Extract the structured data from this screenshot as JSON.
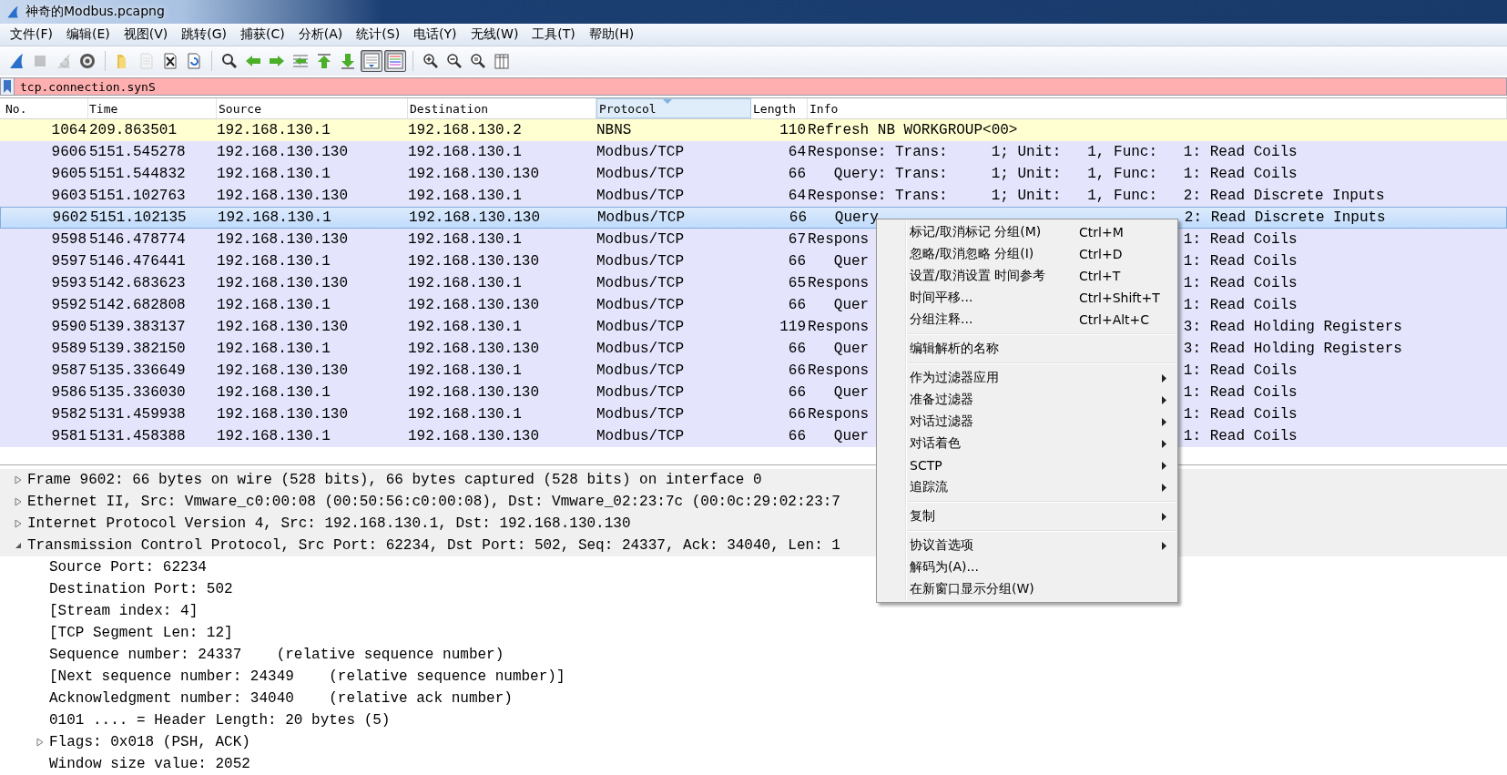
{
  "window": {
    "title": "神奇的Modbus.pcapng"
  },
  "menu_bar": [
    "文件(F)",
    "编辑(E)",
    "视图(V)",
    "跳转(G)",
    "捕获(C)",
    "分析(A)",
    "统计(S)",
    "电话(Y)",
    "无线(W)",
    "工具(T)",
    "帮助(H)"
  ],
  "toolbar": {
    "buttons": [
      {
        "disabled": false,
        "on": false
      },
      {
        "disabled": true,
        "on": false
      },
      {
        "disabled": true,
        "on": false
      },
      {
        "disabled": false,
        "on": false
      },
      {
        "disabled": false,
        "on": false
      },
      {
        "disabled": true,
        "on": false
      },
      {
        "disabled": false,
        "on": false
      },
      {
        "disabled": false,
        "on": false
      },
      {
        "disabled": false,
        "on": false
      },
      {
        "disabled": false,
        "on": false
      },
      {
        "disabled": false,
        "on": false
      },
      {
        "disabled": false,
        "on": false
      },
      {
        "disabled": false,
        "on": false
      },
      {
        "disabled": false,
        "on": false
      },
      {
        "disabled": false,
        "on": true
      },
      {
        "disabled": false,
        "on": true
      },
      {
        "disabled": false,
        "on": false
      },
      {
        "disabled": false,
        "on": false
      },
      {
        "disabled": false,
        "on": false
      },
      {
        "disabled": false,
        "on": false
      }
    ]
  },
  "display_filter": {
    "value": "tcp.connection.synS"
  },
  "packet_list": {
    "columns": [
      {
        "label": "No.",
        "sorted": false
      },
      {
        "label": "Time",
        "sorted": false
      },
      {
        "label": "Source",
        "sorted": false
      },
      {
        "label": "Destination",
        "sorted": false
      },
      {
        "label": "Protocol",
        "sorted": true
      },
      {
        "label": "Length",
        "sorted": false
      },
      {
        "label": "Info",
        "sorted": false
      }
    ],
    "rows": [
      {
        "no": "1064",
        "time": "209.863501",
        "source": "192.168.130.1",
        "destination": "192.168.130.2",
        "protocol": "NBNS",
        "length": "110",
        "info": "Refresh NB WORKGROUP<00>",
        "color": "#ffffd2",
        "selected": false
      },
      {
        "no": "9606",
        "time": "5151.545278",
        "source": "192.168.130.130",
        "destination": "192.168.130.1",
        "protocol": "Modbus/TCP",
        "length": "64",
        "info": "Response: Trans:     1; Unit:   1, Func:   1: Read Coils",
        "color": "#e4e4fc",
        "selected": false
      },
      {
        "no": "9605",
        "time": "5151.544832",
        "source": "192.168.130.1",
        "destination": "192.168.130.130",
        "protocol": "Modbus/TCP",
        "length": "66",
        "info": "   Query: Trans:     1; Unit:   1, Func:   1: Read Coils",
        "color": "#e4e4fc",
        "selected": false
      },
      {
        "no": "9603",
        "time": "5151.102763",
        "source": "192.168.130.130",
        "destination": "192.168.130.1",
        "protocol": "Modbus/TCP",
        "length": "64",
        "info": "Response: Trans:     1; Unit:   1, Func:   2: Read Discrete Inputs",
        "color": "#e4e4fc",
        "selected": false
      },
      {
        "no": "9602",
        "time": "5151.102135",
        "source": "192.168.130.1",
        "destination": "192.168.130.130",
        "protocol": "Modbus/TCP",
        "length": "66",
        "info": "   Query",
        "info_tail": "2: Read Discrete Inputs",
        "selected": true
      },
      {
        "no": "9598",
        "time": "5146.478774",
        "source": "192.168.130.130",
        "destination": "192.168.130.1",
        "protocol": "Modbus/TCP",
        "length": "67",
        "info": "Respons",
        "info_tail": "1: Read Coils",
        "color": "#e4e4fc",
        "selected": false
      },
      {
        "no": "9597",
        "time": "5146.476441",
        "source": "192.168.130.1",
        "destination": "192.168.130.130",
        "protocol": "Modbus/TCP",
        "length": "66",
        "info": "   Quer",
        "info_tail": "1: Read Coils",
        "color": "#e4e4fc",
        "selected": false
      },
      {
        "no": "9593",
        "time": "5142.683623",
        "source": "192.168.130.130",
        "destination": "192.168.130.1",
        "protocol": "Modbus/TCP",
        "length": "65",
        "info": "Respons",
        "info_tail": "1: Read Coils",
        "color": "#e4e4fc",
        "selected": false
      },
      {
        "no": "9592",
        "time": "5142.682808",
        "source": "192.168.130.1",
        "destination": "192.168.130.130",
        "protocol": "Modbus/TCP",
        "length": "66",
        "info": "   Quer",
        "info_tail": "1: Read Coils",
        "color": "#e4e4fc",
        "selected": false
      },
      {
        "no": "9590",
        "time": "5139.383137",
        "source": "192.168.130.130",
        "destination": "192.168.130.1",
        "protocol": "Modbus/TCP",
        "length": "119",
        "info": "Respons",
        "info_tail": "3: Read Holding Registers",
        "color": "#e4e4fc",
        "selected": false
      },
      {
        "no": "9589",
        "time": "5139.382150",
        "source": "192.168.130.1",
        "destination": "192.168.130.130",
        "protocol": "Modbus/TCP",
        "length": "66",
        "info": "   Quer",
        "info_tail": "3: Read Holding Registers",
        "color": "#e4e4fc",
        "selected": false
      },
      {
        "no": "9587",
        "time": "5135.336649",
        "source": "192.168.130.130",
        "destination": "192.168.130.1",
        "protocol": "Modbus/TCP",
        "length": "66",
        "info": "Respons",
        "info_tail": "1: Read Coils",
        "color": "#e4e4fc",
        "selected": false
      },
      {
        "no": "9586",
        "time": "5135.336030",
        "source": "192.168.130.1",
        "destination": "192.168.130.130",
        "protocol": "Modbus/TCP",
        "length": "66",
        "info": "   Quer",
        "info_tail": "1: Read Coils",
        "color": "#e4e4fc",
        "selected": false
      },
      {
        "no": "9582",
        "time": "5131.459938",
        "source": "192.168.130.130",
        "destination": "192.168.130.1",
        "protocol": "Modbus/TCP",
        "length": "66",
        "info": "Respons",
        "info_tail": "1: Read Coils",
        "color": "#e4e4fc",
        "selected": false
      },
      {
        "no": "9581",
        "time": "5131.458388",
        "source": "192.168.130.1",
        "destination": "192.168.130.130",
        "protocol": "Modbus/TCP",
        "length": "66",
        "info": "   Quer",
        "info_tail": "1: Read Coils",
        "color": "#e4e4fc",
        "selected": false
      }
    ]
  },
  "packet_details": [
    {
      "text": "Frame 9602: 66 bytes on wire (528 bits), 66 bytes captured (528 bits) on interface 0",
      "expanded": false
    },
    {
      "text": "Ethernet II, Src: Vmware_c0:00:08 (00:50:56:c0:00:08), Dst: Vmware_02:23:7c (00:0c:29:02:23:7",
      "expanded": false
    },
    {
      "text": "Internet Protocol Version 4, Src: 192.168.130.1, Dst: 192.168.130.130",
      "expanded": false
    },
    {
      "text": "Transmission Control Protocol, Src Port: 62234, Dst Port: 502, Seq: 24337, Ack: 34040, Len: 1",
      "expanded": true,
      "children": [
        {
          "text": "Source Port: 62234"
        },
        {
          "text": "Destination Port: 502"
        },
        {
          "text": "[Stream index: 4]"
        },
        {
          "text": "[TCP Segment Len: 12]"
        },
        {
          "text": "Sequence number: 24337    (relative sequence number)"
        },
        {
          "text": "[Next sequence number: 24349    (relative sequence number)]"
        },
        {
          "text": "Acknowledgment number: 34040    (relative ack number)"
        },
        {
          "text": "0101 .... = Header Length: 20 bytes (5)"
        },
        {
          "text": "Flags: 0x018 (PSH, ACK)",
          "expanded": false
        },
        {
          "text": "Window size value: 2052"
        }
      ]
    }
  ],
  "context_menu": {
    "groups": [
      [
        {
          "label": "标记/取消标记 分组(M)",
          "shortcut": "Ctrl+M",
          "submenu": false
        },
        {
          "label": "忽略/取消忽略 分组(I)",
          "shortcut": "Ctrl+D",
          "submenu": false
        },
        {
          "label": "设置/取消设置 时间参考",
          "shortcut": "Ctrl+T",
          "submenu": false
        },
        {
          "label": "时间平移...",
          "shortcut": "Ctrl+Shift+T",
          "submenu": false
        },
        {
          "label": "分组注释...",
          "shortcut": "Ctrl+Alt+C",
          "submenu": false
        }
      ],
      [
        {
          "label": "编辑解析的名称",
          "submenu": false
        }
      ],
      [
        {
          "label": "作为过滤器应用",
          "submenu": true
        },
        {
          "label": "准备过滤器",
          "submenu": true
        },
        {
          "label": "对话过滤器",
          "submenu": true
        },
        {
          "label": "对话着色",
          "submenu": true
        },
        {
          "label": "SCTP",
          "submenu": true
        },
        {
          "label": "追踪流",
          "submenu": true
        }
      ],
      [
        {
          "label": "复制",
          "submenu": true
        }
      ],
      [
        {
          "label": "协议首选项",
          "submenu": true
        },
        {
          "label": "解码为(A)...",
          "submenu": false
        },
        {
          "label": "在新窗口显示分组(W)",
          "submenu": false
        }
      ]
    ]
  }
}
